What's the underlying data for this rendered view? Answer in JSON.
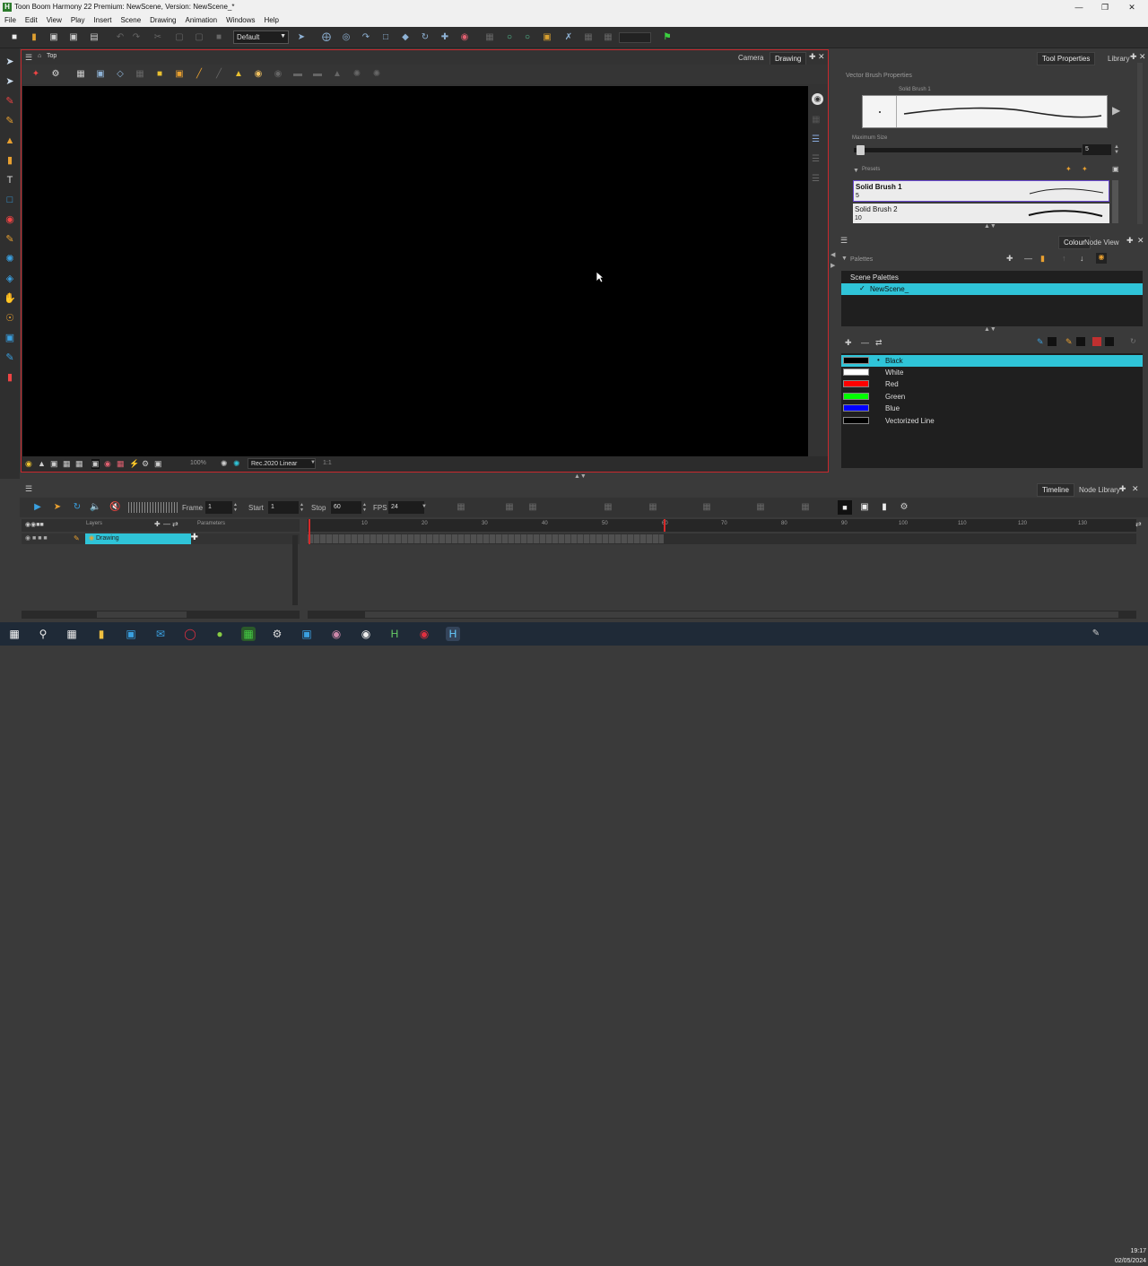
{
  "window": {
    "title": "Toon Boom Harmony 22 Premium: NewScene, Version: NewScene_*"
  },
  "menu": [
    "File",
    "Edit",
    "View",
    "Play",
    "Insert",
    "Scene",
    "Drawing",
    "Animation",
    "Windows",
    "Help"
  ],
  "toolbar": {
    "workspace_preset": "Default"
  },
  "camera_view": {
    "view_label": "Top",
    "tabs": [
      {
        "label": "Camera",
        "active": false
      },
      {
        "label": "Drawing",
        "active": true
      }
    ],
    "zoom": "100%",
    "color_space": "Rec.2020 Linear",
    "ratio": "1:1"
  },
  "tool_properties": {
    "tabs": [
      {
        "label": "Tool Properties",
        "active": true
      },
      {
        "label": "Library",
        "active": false
      }
    ],
    "header": "Vector Brush Properties",
    "brush_name": "Solid Brush 1",
    "max_size_label": "Maximum Size",
    "max_size_value": "5",
    "presets_label": "Presets",
    "presets": [
      {
        "name": "Solid Brush 1",
        "size": "5",
        "selected": true
      },
      {
        "name": "Solid Brush 2",
        "size": "10",
        "selected": false
      }
    ]
  },
  "colour_panel": {
    "tabs": [
      {
        "label": "Colour",
        "active": true
      },
      {
        "label": "Node View",
        "active": false
      }
    ],
    "palettes_label": "Palettes",
    "scene_palettes_label": "Scene Palettes",
    "palette_name": "NewScene_",
    "colours": [
      {
        "name": "Black",
        "hex": "#000000",
        "selected": true
      },
      {
        "name": "White",
        "hex": "#ffffff",
        "selected": false
      },
      {
        "name": "Red",
        "hex": "#ff0000",
        "selected": false
      },
      {
        "name": "Green",
        "hex": "#00ff00",
        "selected": false
      },
      {
        "name": "Blue",
        "hex": "#0000ff",
        "selected": false
      },
      {
        "name": "Vectorized Line",
        "hex": "#000000",
        "selected": false
      }
    ]
  },
  "timeline": {
    "tabs": [
      {
        "label": "Timeline",
        "active": true
      },
      {
        "label": "Node Library",
        "active": false
      }
    ],
    "frame_label": "Frame",
    "frame_value": "1",
    "start_label": "Start",
    "start_value": "1",
    "stop_label": "Stop",
    "stop_value": "60",
    "fps_label": "FPS",
    "fps_value": "24",
    "layers_label": "Layers",
    "parameters_label": "Parameters",
    "layer_name": "Drawing",
    "ruler_ticks": [
      "10",
      "20",
      "30",
      "40",
      "50",
      "60",
      "70",
      "80",
      "90",
      "100",
      "110",
      "120",
      "130"
    ]
  },
  "taskbar": {
    "time": "19:17",
    "date": "02/05/2024"
  },
  "colors": {
    "accent": "#2fc4d8",
    "view_border": "#c8282d",
    "playhead": "#d52a2a"
  }
}
